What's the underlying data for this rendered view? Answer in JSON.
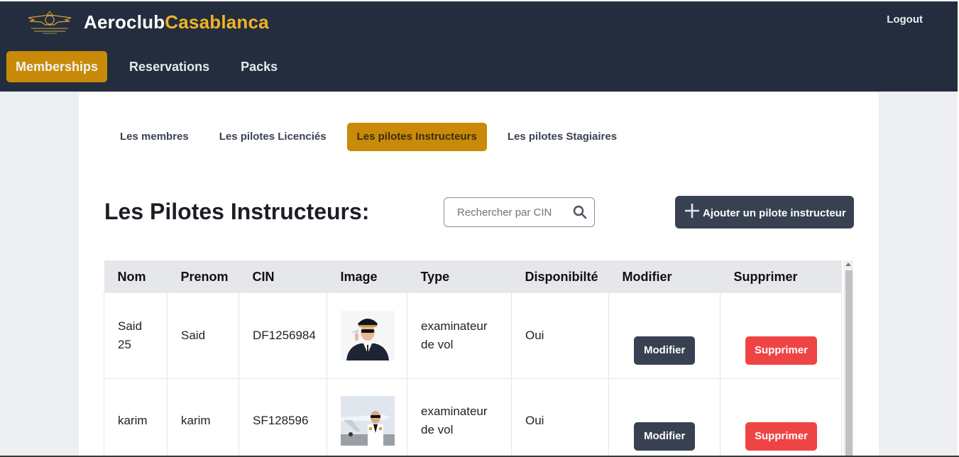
{
  "brand": {
    "name_part1": "Aeroclub",
    "name_part2": "Casablanca",
    "logo_icon": "aeroclub-wings-logo"
  },
  "header": {
    "logout_label": "Logout",
    "nav": [
      {
        "label": "Memberships",
        "active": true
      },
      {
        "label": "Reservations",
        "active": false
      },
      {
        "label": "Packs",
        "active": false
      }
    ]
  },
  "subtabs": [
    {
      "label": "Les membres",
      "active": false
    },
    {
      "label": "Les pilotes Licenciés",
      "active": false
    },
    {
      "label": "Les pilotes Instructeurs",
      "active": true
    },
    {
      "label": "Les pilotes Stagiaires",
      "active": false
    }
  ],
  "page": {
    "title": "Les Pilotes Instructeurs:",
    "search_placeholder": "Rechercher par CIN",
    "add_button_label": "Ajouter un pilote instructeur"
  },
  "table": {
    "columns": [
      "Nom",
      "Prenom",
      "CIN",
      "Image",
      "Type",
      "Disponibilté",
      "Modifier",
      "Supprimer"
    ],
    "rows": [
      {
        "nom": "Said 25",
        "prenom": "Said",
        "cin": "DF1256984",
        "image": "pilot-portrait-photo",
        "type": "examinateur de vol",
        "dispo": "Oui",
        "modifier": "Modifier",
        "supprimer": "Supprimer"
      },
      {
        "nom": "karim",
        "prenom": "karim",
        "cin": "SF128596",
        "image": "pilot-jet-photo",
        "type": "examinateur de vol",
        "dispo": "Oui",
        "modifier": "Modifier",
        "supprimer": "Supprimer"
      }
    ]
  },
  "colors": {
    "navbar_bg": "#232d3d",
    "accent_gold": "#c88a08",
    "brand_yellow": "#f1b226",
    "button_dark": "#384152",
    "button_danger": "#ef4444"
  }
}
